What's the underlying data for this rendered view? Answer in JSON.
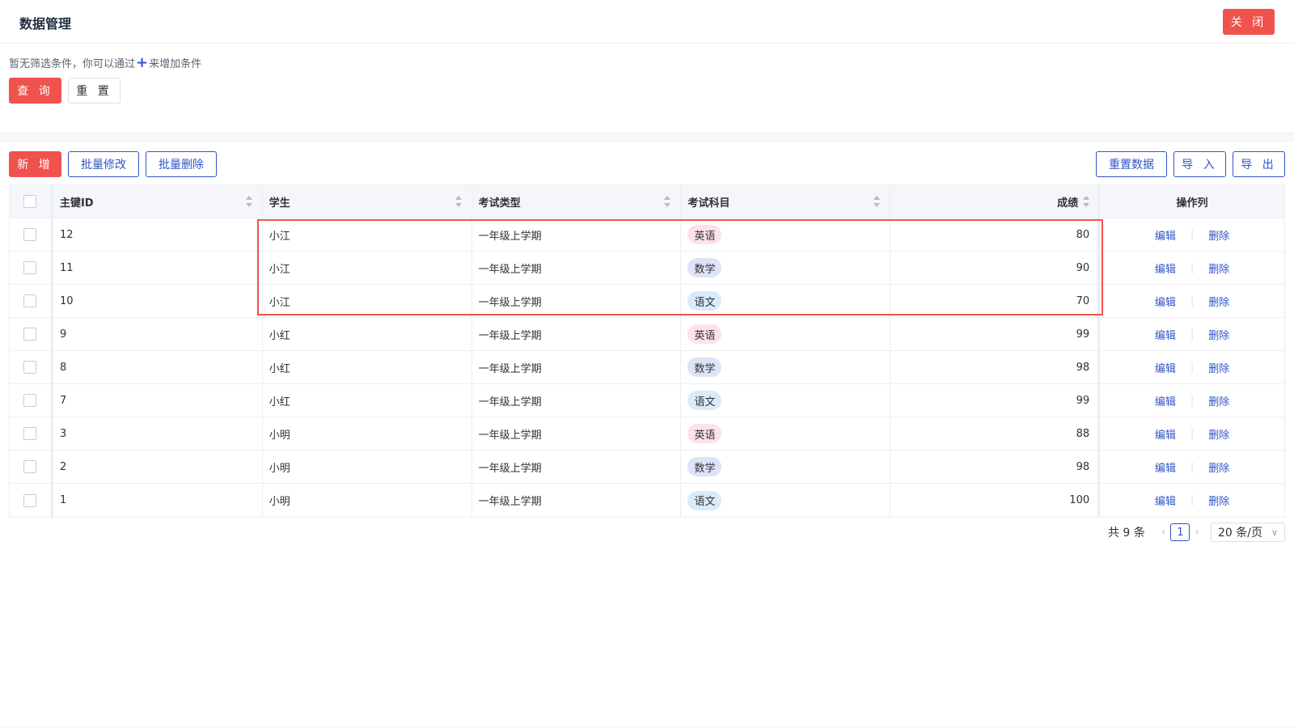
{
  "header": {
    "title": "数据管理",
    "close_label": "关 闭"
  },
  "filter": {
    "hint_before": "暂无筛选条件，你可以通过",
    "plus_symbol": "+",
    "hint_after": "来增加条件",
    "query_label": "查 询",
    "reset_label": "重 置"
  },
  "toolbar": {
    "add_label": "新 增",
    "batch_edit_label": "批量修改",
    "batch_delete_label": "批量删除",
    "reset_data_label": "重置数据",
    "import_label": "导 入",
    "export_label": "导 出"
  },
  "table": {
    "columns": {
      "id": "主键ID",
      "student": "学生",
      "exam_type": "考试类型",
      "subject": "考试科目",
      "score": "成绩",
      "ops": "操作列"
    },
    "edit_label": "编辑",
    "delete_label": "删除",
    "separator": "|",
    "rows": [
      {
        "id": "12",
        "student": "小江",
        "exam_type": "一年级上学期",
        "subject": "英语",
        "score": "80"
      },
      {
        "id": "11",
        "student": "小江",
        "exam_type": "一年级上学期",
        "subject": "数学",
        "score": "90"
      },
      {
        "id": "10",
        "student": "小江",
        "exam_type": "一年级上学期",
        "subject": "语文",
        "score": "70"
      },
      {
        "id": "9",
        "student": "小红",
        "exam_type": "一年级上学期",
        "subject": "英语",
        "score": "99"
      },
      {
        "id": "8",
        "student": "小红",
        "exam_type": "一年级上学期",
        "subject": "数学",
        "score": "98"
      },
      {
        "id": "7",
        "student": "小红",
        "exam_type": "一年级上学期",
        "subject": "语文",
        "score": "99"
      },
      {
        "id": "3",
        "student": "小明",
        "exam_type": "一年级上学期",
        "subject": "英语",
        "score": "88"
      },
      {
        "id": "2",
        "student": "小明",
        "exam_type": "一年级上学期",
        "subject": "数学",
        "score": "98"
      },
      {
        "id": "1",
        "student": "小明",
        "exam_type": "一年级上学期",
        "subject": "语文",
        "score": "100"
      }
    ]
  },
  "pagination": {
    "total_text": "共 9 条",
    "current_page": "1",
    "page_size_label": "20 条/页"
  },
  "colors": {
    "primary_red": "#f0524d",
    "link_blue": "#2f54c8",
    "tag_english": "#fde2ea",
    "tag_math": "#dfe3f8",
    "tag_chinese": "#d9ebfb"
  }
}
